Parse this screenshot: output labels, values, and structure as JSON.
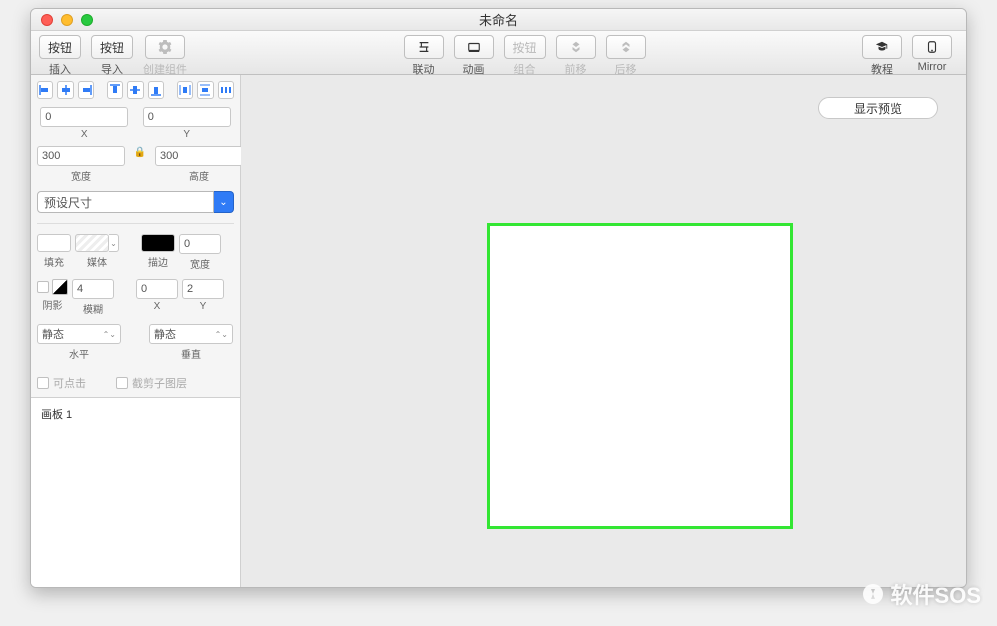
{
  "window": {
    "title": "未命名"
  },
  "toolbar": {
    "insert": {
      "btn": "按钮",
      "label": "插入"
    },
    "import": {
      "btn": "按钮",
      "label": "导入"
    },
    "create_component": {
      "label": "创建组件"
    },
    "link": {
      "label": "联动"
    },
    "animation": {
      "label": "动画"
    },
    "group": {
      "btn": "按钮",
      "label": "组合"
    },
    "forward": {
      "label": "前移"
    },
    "backward": {
      "label": "后移"
    },
    "tutorial": {
      "label": "教程"
    },
    "mirror": {
      "label": "Mirror"
    }
  },
  "inspector": {
    "x": {
      "value": "0",
      "label": "X"
    },
    "y": {
      "value": "0",
      "label": "Y"
    },
    "width": {
      "value": "300",
      "label": "宽度"
    },
    "height": {
      "value": "300",
      "label": "高度"
    },
    "preset": {
      "label": "预设尺寸"
    },
    "fill": {
      "label": "填充"
    },
    "media": {
      "label": "媒体"
    },
    "stroke": {
      "label": "描边"
    },
    "stroke_width": {
      "value": "0",
      "label": "宽度"
    },
    "shadow": {
      "label": "阴影"
    },
    "blur": {
      "value": "4",
      "label": "模糊"
    },
    "shadow_x": {
      "value": "0",
      "label": "X"
    },
    "shadow_y": {
      "value": "2",
      "label": "Y"
    },
    "scroll_h": {
      "value": "静态",
      "label": "水平"
    },
    "scroll_v": {
      "value": "静态",
      "label": "垂直"
    },
    "clickable": {
      "label": "可点击"
    },
    "clip": {
      "label": "截剪子图层"
    }
  },
  "artboards": {
    "items": [
      "画板 1"
    ]
  },
  "canvas": {
    "preview_btn": "显示预览"
  },
  "watermark": "软件SOS"
}
